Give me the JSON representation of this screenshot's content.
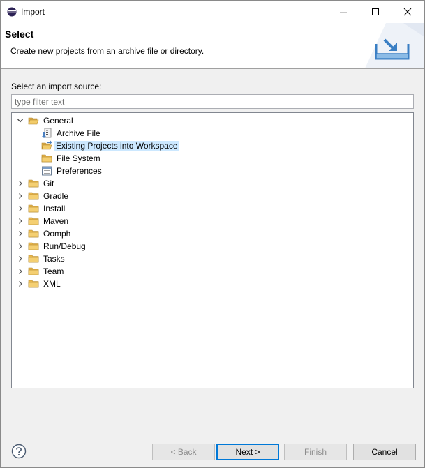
{
  "window": {
    "title": "Import",
    "app_icon": "eclipse-icon",
    "controls": [
      "minimize-icon",
      "maximize-icon",
      "close-icon"
    ]
  },
  "header": {
    "title": "Select",
    "description": "Create new projects from an archive file or directory.",
    "image": "import-wizard-icon"
  },
  "source": {
    "label": "Select an import source:",
    "filter_placeholder": "type filter text",
    "filter_value": ""
  },
  "tree": {
    "items": [
      {
        "label": "General",
        "icon": "folder-open-icon",
        "expanded": true
      },
      {
        "label": "Archive File",
        "icon": "archive-file-icon"
      },
      {
        "label": "Existing Projects into Workspace",
        "icon": "existing-projects-icon",
        "selected": true
      },
      {
        "label": "File System",
        "icon": "folder-icon"
      },
      {
        "label": "Preferences",
        "icon": "preferences-icon"
      },
      {
        "label": "Git",
        "icon": "folder-icon",
        "expanded": false
      },
      {
        "label": "Gradle",
        "icon": "folder-icon",
        "expanded": false
      },
      {
        "label": "Install",
        "icon": "folder-icon",
        "expanded": false
      },
      {
        "label": "Maven",
        "icon": "folder-icon",
        "expanded": false
      },
      {
        "label": "Oomph",
        "icon": "folder-icon",
        "expanded": false
      },
      {
        "label": "Run/Debug",
        "icon": "folder-icon",
        "expanded": false
      },
      {
        "label": "Tasks",
        "icon": "folder-icon",
        "expanded": false
      },
      {
        "label": "Team",
        "icon": "folder-icon",
        "expanded": false
      },
      {
        "label": "XML",
        "icon": "folder-icon",
        "expanded": false
      }
    ]
  },
  "buttons": {
    "help_icon": "help-icon",
    "back": "< Back",
    "next": "Next >",
    "finish": "Finish",
    "cancel": "Cancel"
  },
  "colors": {
    "selection": "#cce8ff",
    "folder": "#e8b64c",
    "default_button_border": "#0078d7"
  }
}
